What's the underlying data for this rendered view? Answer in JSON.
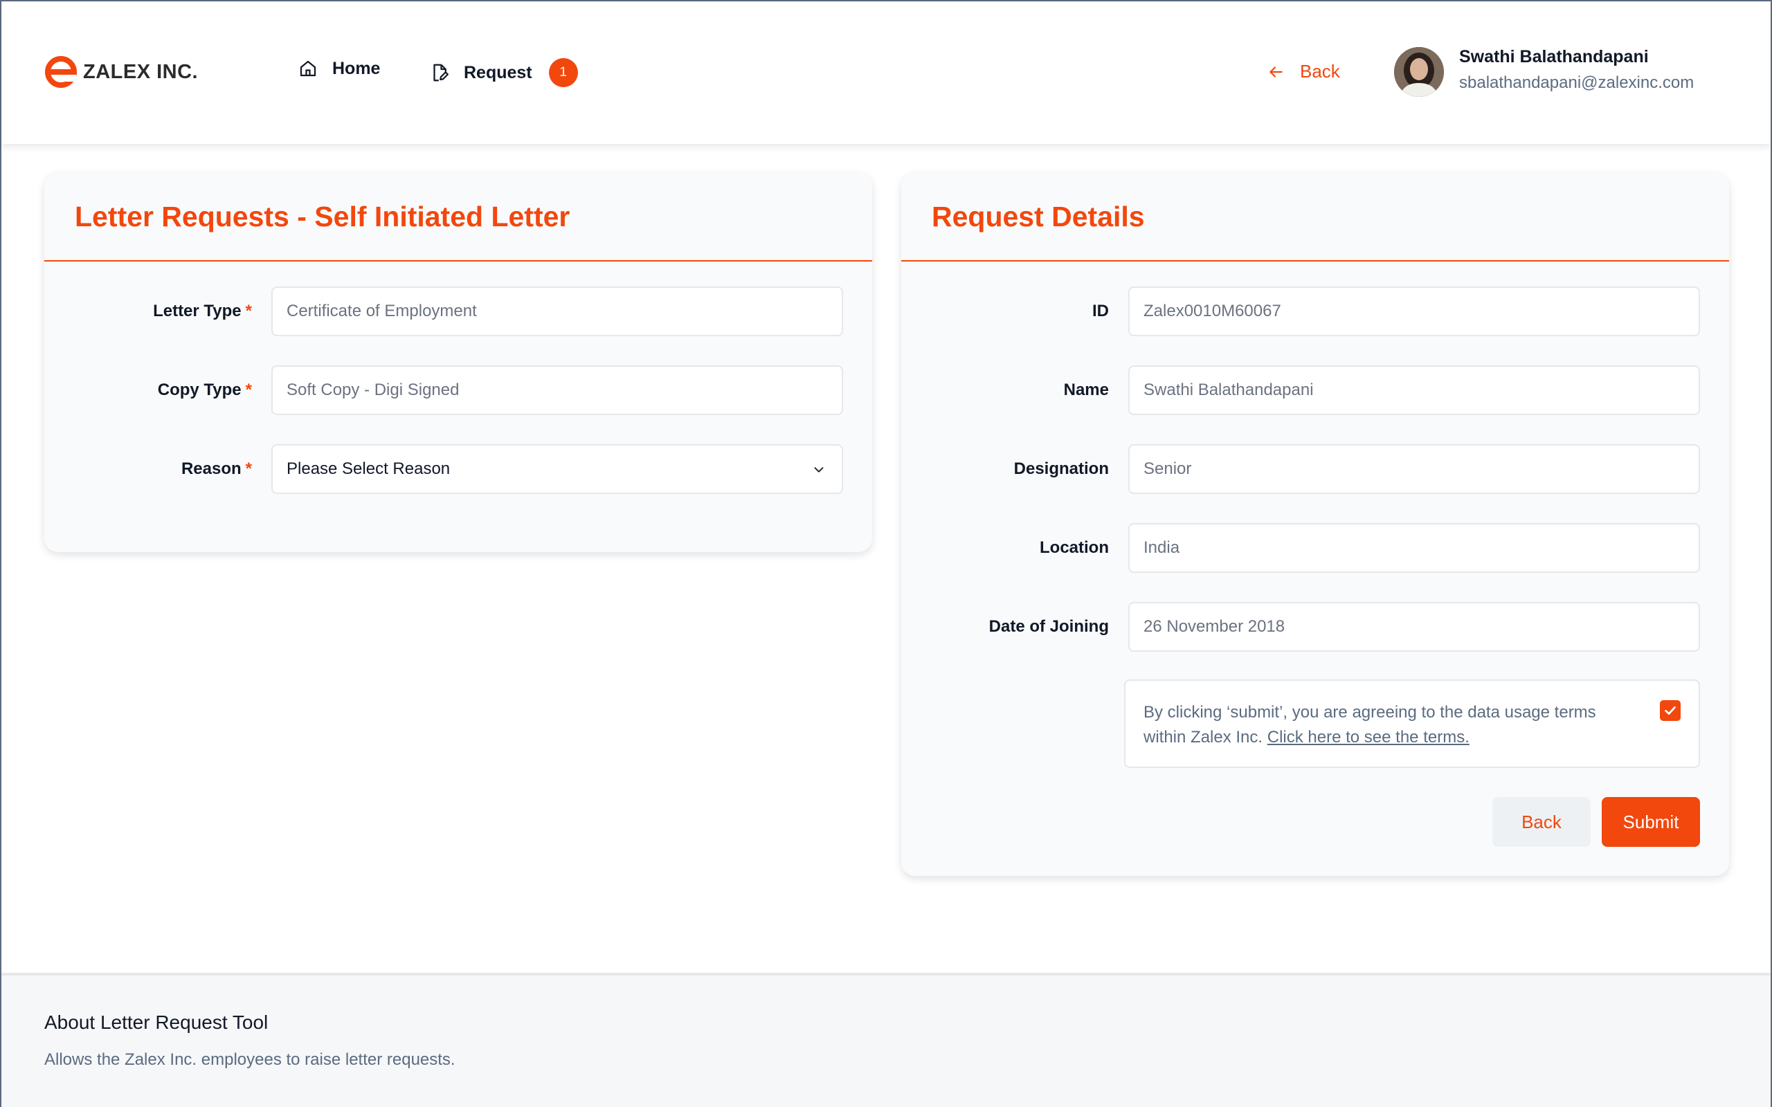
{
  "header": {
    "logo_text": "ZALEX INC.",
    "nav": [
      {
        "label": "Home",
        "icon": "home-icon"
      },
      {
        "label": "Request",
        "icon": "document-edit-icon",
        "badge": "1"
      }
    ],
    "back_label": "Back",
    "user": {
      "name": "Swathi Balathandapani",
      "email": "sbalathandapani@zalexinc.com"
    }
  },
  "left_card": {
    "title": "Letter Requests - Self Initiated Letter",
    "fields": [
      {
        "label": "Letter Type",
        "required": "*",
        "placeholder": "Certificate of Employment"
      },
      {
        "label": "Copy Type",
        "required": "*",
        "placeholder": "Soft Copy - Digi Signed"
      },
      {
        "label": "Reason",
        "required": "*",
        "value": "Please Select Reason"
      }
    ]
  },
  "right_card": {
    "title": "Request Details",
    "fields": [
      {
        "label": "ID",
        "value": "Zalex0010M60067"
      },
      {
        "label": "Name",
        "value": "Swathi Balathandapani"
      },
      {
        "label": "Designation",
        "value": "Senior"
      },
      {
        "label": "Location",
        "value": "India"
      },
      {
        "label": "Date of Joining",
        "value": "26 November 2018"
      }
    ],
    "terms_text": "By clicking ‘submit’, you are agreeing to the data usage terms within Zalex Inc.",
    "terms_link": "Click here to see the terms.",
    "terms_checked": true,
    "back_button": "Back",
    "submit_button": "Submit"
  },
  "footer": {
    "title": "About Letter Request Tool",
    "description": "Allows the Zalex Inc. employees to raise letter requests."
  },
  "colors": {
    "accent": "#f2470d",
    "muted_text": "#5b6b80",
    "card_bg": "#f9fafb"
  }
}
